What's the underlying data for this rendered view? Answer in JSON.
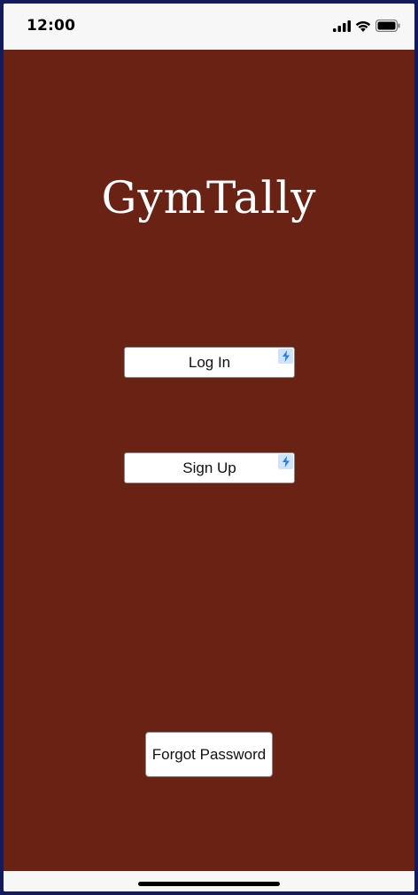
{
  "status_bar": {
    "time": "12:00",
    "icons": [
      "cellular-signal-icon",
      "wifi-icon",
      "battery-icon"
    ]
  },
  "app": {
    "title": "GymTally",
    "background_color": "#6a2215"
  },
  "buttons": {
    "login_label": "Log In",
    "signup_label": "Sign Up",
    "forgot_label": "Forgot Password"
  },
  "badge_icon": "lightning-bolt-icon",
  "colors": {
    "badge_bg": "#cfe3fb",
    "badge_bolt": "#2f7de1",
    "frame": "#141a5e"
  }
}
